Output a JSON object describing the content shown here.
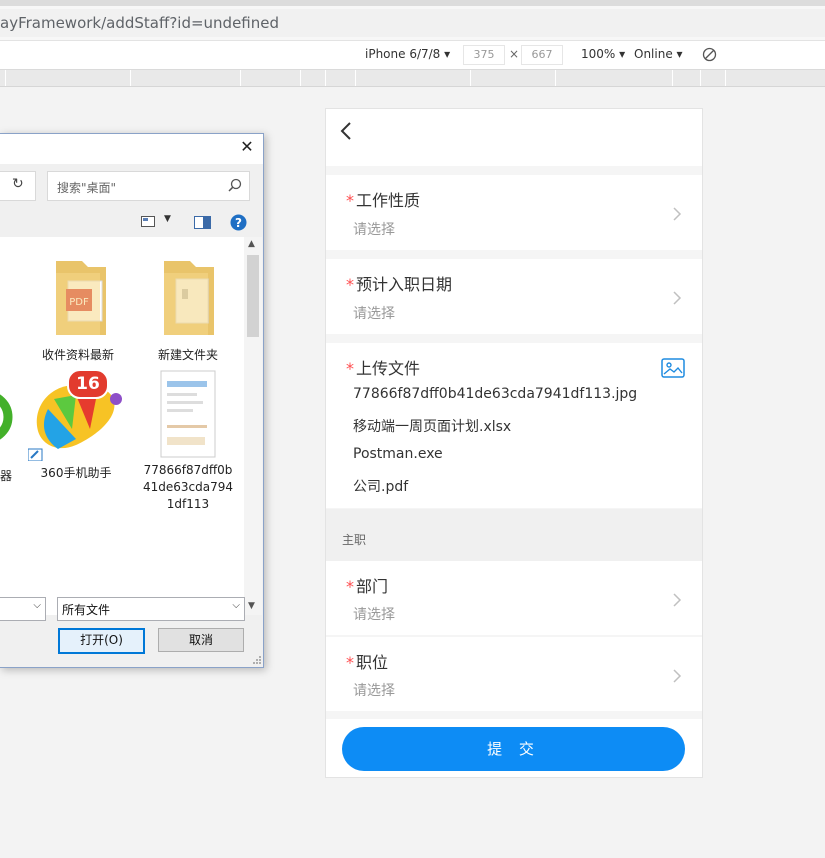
{
  "browser": {
    "url": "ayFramework/addStaff?id=undefined",
    "device": "iPhone 6/7/8",
    "width": "375",
    "height": "667",
    "zoom": "100%",
    "throttle": "Online"
  },
  "phone": {
    "fields": [
      {
        "label": "工作性质",
        "placeholder": "请选择"
      },
      {
        "label": "预计入职日期",
        "placeholder": "请选择"
      }
    ],
    "upload": {
      "label": "上传文件",
      "files": [
        "77866f87dff0b41de63cda7941df113.jpg",
        "移动端一周页面计划.xlsx",
        "Postman.exe",
        "公司.pdf"
      ]
    },
    "group_title": "主职",
    "group_fields": [
      {
        "label": "部门",
        "placeholder": "请选择"
      },
      {
        "label": "职位",
        "placeholder": "请选择"
      }
    ],
    "submit_label": "提 交",
    "required_mark": "*"
  },
  "dialog": {
    "search_placeholder": "搜索\"桌面\"",
    "items": [
      {
        "name": "收件资料最新",
        "icon": "folder-pdf-icon"
      },
      {
        "name": "新建文件夹",
        "icon": "folder-icon"
      },
      {
        "name": "器",
        "icon": "app-green-icon"
      },
      {
        "name": "360手机助手",
        "icon": "360-assistant-icon",
        "badge": "16"
      },
      {
        "name": "77866f87dff0b41de63cda7941df113",
        "icon": "image-thumbnail-icon"
      }
    ],
    "filetype": "所有文件",
    "open_label": "打开(O)",
    "cancel_label": "取消"
  },
  "colors": {
    "accent": "#0d8cf5",
    "required": "#ff4d4f",
    "placeholder": "#999999"
  }
}
